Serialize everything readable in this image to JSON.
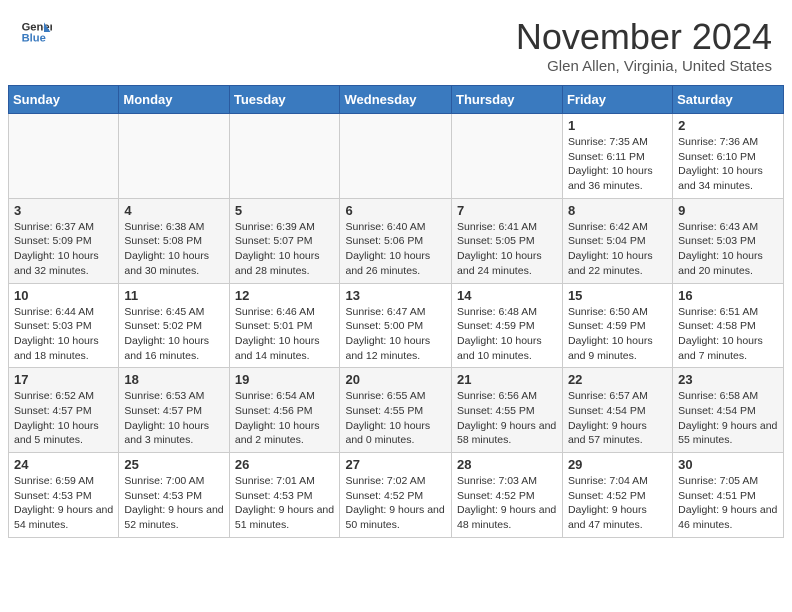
{
  "header": {
    "logo_general": "General",
    "logo_blue": "Blue",
    "month_title": "November 2024",
    "location": "Glen Allen, Virginia, United States"
  },
  "calendar": {
    "days_of_week": [
      "Sunday",
      "Monday",
      "Tuesday",
      "Wednesday",
      "Thursday",
      "Friday",
      "Saturday"
    ],
    "weeks": [
      [
        {
          "day": "",
          "info": ""
        },
        {
          "day": "",
          "info": ""
        },
        {
          "day": "",
          "info": ""
        },
        {
          "day": "",
          "info": ""
        },
        {
          "day": "",
          "info": ""
        },
        {
          "day": "1",
          "info": "Sunrise: 7:35 AM\nSunset: 6:11 PM\nDaylight: 10 hours and 36 minutes."
        },
        {
          "day": "2",
          "info": "Sunrise: 7:36 AM\nSunset: 6:10 PM\nDaylight: 10 hours and 34 minutes."
        }
      ],
      [
        {
          "day": "3",
          "info": "Sunrise: 6:37 AM\nSunset: 5:09 PM\nDaylight: 10 hours and 32 minutes."
        },
        {
          "day": "4",
          "info": "Sunrise: 6:38 AM\nSunset: 5:08 PM\nDaylight: 10 hours and 30 minutes."
        },
        {
          "day": "5",
          "info": "Sunrise: 6:39 AM\nSunset: 5:07 PM\nDaylight: 10 hours and 28 minutes."
        },
        {
          "day": "6",
          "info": "Sunrise: 6:40 AM\nSunset: 5:06 PM\nDaylight: 10 hours and 26 minutes."
        },
        {
          "day": "7",
          "info": "Sunrise: 6:41 AM\nSunset: 5:05 PM\nDaylight: 10 hours and 24 minutes."
        },
        {
          "day": "8",
          "info": "Sunrise: 6:42 AM\nSunset: 5:04 PM\nDaylight: 10 hours and 22 minutes."
        },
        {
          "day": "9",
          "info": "Sunrise: 6:43 AM\nSunset: 5:03 PM\nDaylight: 10 hours and 20 minutes."
        }
      ],
      [
        {
          "day": "10",
          "info": "Sunrise: 6:44 AM\nSunset: 5:03 PM\nDaylight: 10 hours and 18 minutes."
        },
        {
          "day": "11",
          "info": "Sunrise: 6:45 AM\nSunset: 5:02 PM\nDaylight: 10 hours and 16 minutes."
        },
        {
          "day": "12",
          "info": "Sunrise: 6:46 AM\nSunset: 5:01 PM\nDaylight: 10 hours and 14 minutes."
        },
        {
          "day": "13",
          "info": "Sunrise: 6:47 AM\nSunset: 5:00 PM\nDaylight: 10 hours and 12 minutes."
        },
        {
          "day": "14",
          "info": "Sunrise: 6:48 AM\nSunset: 4:59 PM\nDaylight: 10 hours and 10 minutes."
        },
        {
          "day": "15",
          "info": "Sunrise: 6:50 AM\nSunset: 4:59 PM\nDaylight: 10 hours and 9 minutes."
        },
        {
          "day": "16",
          "info": "Sunrise: 6:51 AM\nSunset: 4:58 PM\nDaylight: 10 hours and 7 minutes."
        }
      ],
      [
        {
          "day": "17",
          "info": "Sunrise: 6:52 AM\nSunset: 4:57 PM\nDaylight: 10 hours and 5 minutes."
        },
        {
          "day": "18",
          "info": "Sunrise: 6:53 AM\nSunset: 4:57 PM\nDaylight: 10 hours and 3 minutes."
        },
        {
          "day": "19",
          "info": "Sunrise: 6:54 AM\nSunset: 4:56 PM\nDaylight: 10 hours and 2 minutes."
        },
        {
          "day": "20",
          "info": "Sunrise: 6:55 AM\nSunset: 4:55 PM\nDaylight: 10 hours and 0 minutes."
        },
        {
          "day": "21",
          "info": "Sunrise: 6:56 AM\nSunset: 4:55 PM\nDaylight: 9 hours and 58 minutes."
        },
        {
          "day": "22",
          "info": "Sunrise: 6:57 AM\nSunset: 4:54 PM\nDaylight: 9 hours and 57 minutes."
        },
        {
          "day": "23",
          "info": "Sunrise: 6:58 AM\nSunset: 4:54 PM\nDaylight: 9 hours and 55 minutes."
        }
      ],
      [
        {
          "day": "24",
          "info": "Sunrise: 6:59 AM\nSunset: 4:53 PM\nDaylight: 9 hours and 54 minutes."
        },
        {
          "day": "25",
          "info": "Sunrise: 7:00 AM\nSunset: 4:53 PM\nDaylight: 9 hours and 52 minutes."
        },
        {
          "day": "26",
          "info": "Sunrise: 7:01 AM\nSunset: 4:53 PM\nDaylight: 9 hours and 51 minutes."
        },
        {
          "day": "27",
          "info": "Sunrise: 7:02 AM\nSunset: 4:52 PM\nDaylight: 9 hours and 50 minutes."
        },
        {
          "day": "28",
          "info": "Sunrise: 7:03 AM\nSunset: 4:52 PM\nDaylight: 9 hours and 48 minutes."
        },
        {
          "day": "29",
          "info": "Sunrise: 7:04 AM\nSunset: 4:52 PM\nDaylight: 9 hours and 47 minutes."
        },
        {
          "day": "30",
          "info": "Sunrise: 7:05 AM\nSunset: 4:51 PM\nDaylight: 9 hours and 46 minutes."
        }
      ]
    ]
  }
}
